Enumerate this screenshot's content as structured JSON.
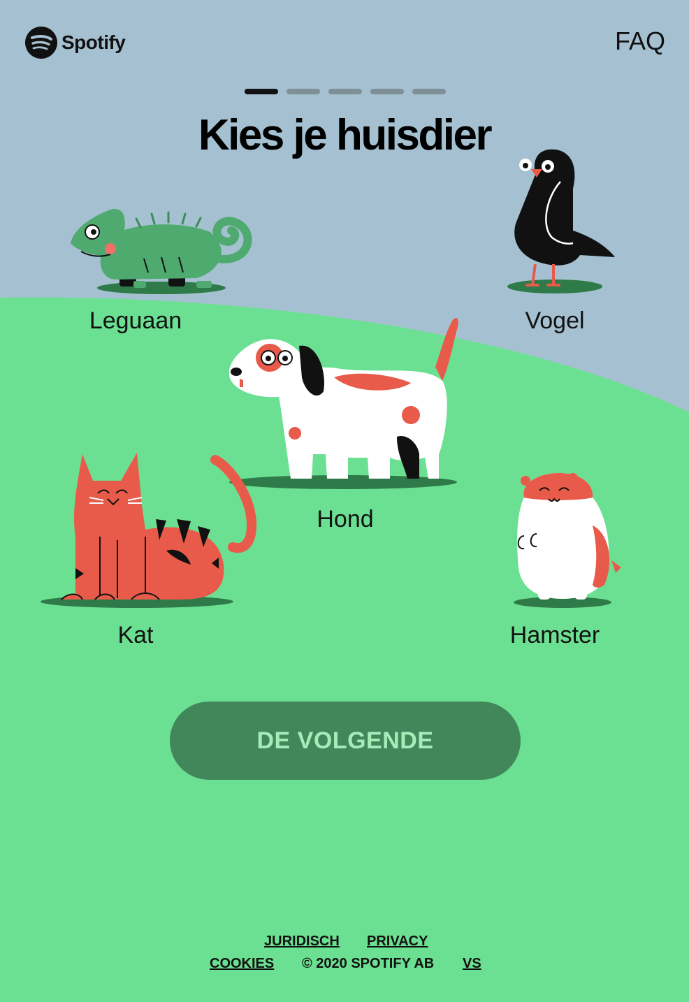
{
  "header": {
    "brand": "Spotify",
    "faq_label": "FAQ"
  },
  "progress": {
    "total_steps": 5,
    "current_step": 1
  },
  "title": "Kies je huisdier",
  "pets": [
    {
      "id": "leguaan",
      "label": "Leguaan"
    },
    {
      "id": "vogel",
      "label": "Vogel"
    },
    {
      "id": "hond",
      "label": "Hond"
    },
    {
      "id": "kat",
      "label": "Kat"
    },
    {
      "id": "hamster",
      "label": "Hamster"
    }
  ],
  "next_button": {
    "label": "DE VOLGENDE"
  },
  "footer": {
    "juridisch": "JURIDISCH",
    "privacy": "PRIVACY",
    "cookies": "COOKIES",
    "copyright": "© 2020 SPOTIFY AB",
    "region": "VS"
  },
  "colors": {
    "sky": "#a5c1d1",
    "grass": "#6ce092",
    "button": "#41875a",
    "button_text": "#a6ecb9",
    "accent_red": "#e85a4a"
  }
}
